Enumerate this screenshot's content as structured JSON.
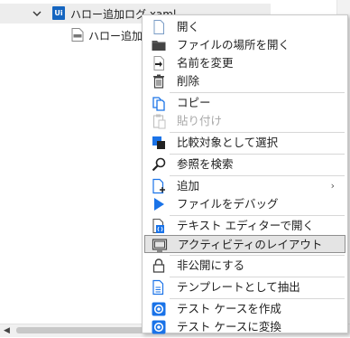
{
  "tree": {
    "root_label": "ハロー追加ログ.xaml",
    "root_badge": "Ui",
    "child_label": "ハロー追加"
  },
  "menu": {
    "items": [
      {
        "label": "開く",
        "icon": "blank-document-icon"
      },
      {
        "label": "ファイルの場所を開く",
        "icon": "folder-icon"
      },
      {
        "label": "名前を変更",
        "icon": "rename-icon"
      },
      {
        "label": "削除",
        "icon": "trash-icon"
      },
      {
        "label": "コピー",
        "icon": "copy-icon"
      },
      {
        "label": "貼り付け",
        "icon": "paste-icon",
        "disabled": true
      },
      {
        "label": "比較対象として選択",
        "icon": "compare-icon"
      },
      {
        "label": "参照を検索",
        "icon": "magnifier-icon"
      },
      {
        "label": "追加",
        "icon": "add-document-icon",
        "submenu": true
      },
      {
        "label": "ファイルをデバッグ",
        "icon": "play-icon"
      },
      {
        "label": "テキスト エディターで開く",
        "icon": "text-editor-icon"
      },
      {
        "label": "アクティビティのレイアウト",
        "icon": "layout-icon",
        "hovered": true
      },
      {
        "label": "非公開にする",
        "icon": "lock-icon"
      },
      {
        "label": "テンプレートとして抽出",
        "icon": "template-icon"
      },
      {
        "label": "テスト ケースを作成",
        "icon": "test-case-icon"
      },
      {
        "label": "テスト ケースに変換",
        "icon": "test-case-icon"
      }
    ],
    "submenu_arrow": "›"
  },
  "colors": {
    "accent": "#1a73e8",
    "tree_selected_bg": "#ededed",
    "menu_hover_bg": "#e4e4e4",
    "disabled_text": "#a9a9a9"
  }
}
